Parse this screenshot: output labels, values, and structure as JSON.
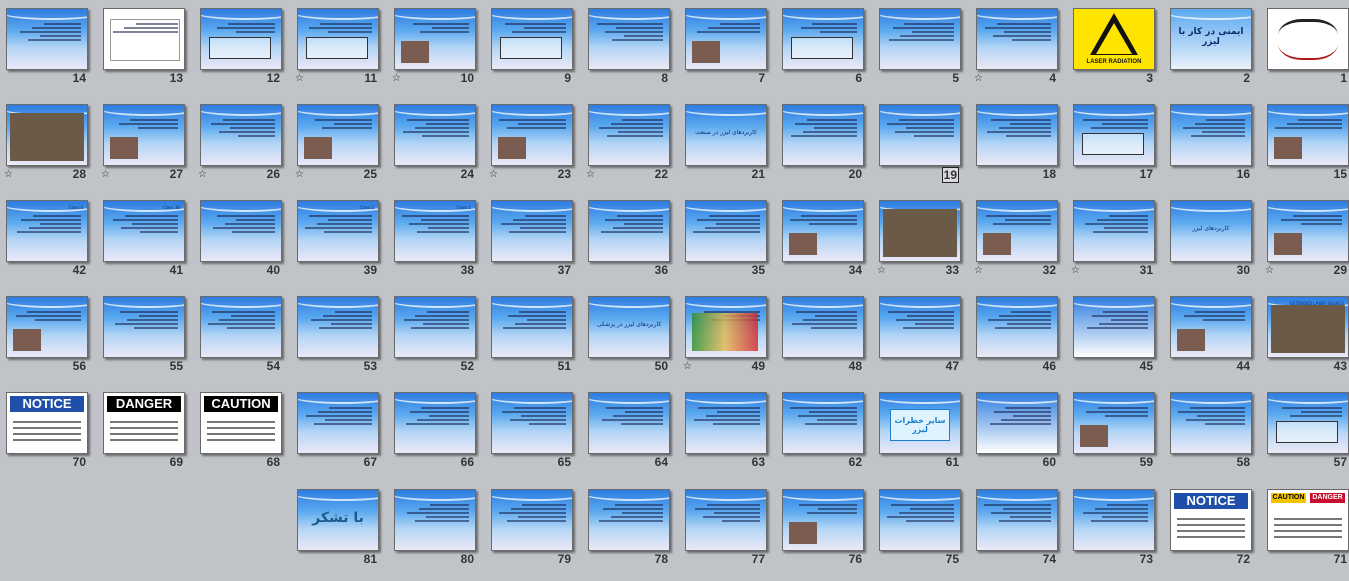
{
  "window": {
    "view": "Slide Sorter"
  },
  "slides": [
    {
      "num": "14",
      "kind": "text",
      "title": "",
      "star": false
    },
    {
      "num": "13",
      "kind": "diagram-white",
      "title": "",
      "star": false
    },
    {
      "num": "12",
      "kind": "diagram",
      "title": "",
      "star": false
    },
    {
      "num": "11",
      "kind": "diagram",
      "title": "",
      "star": true
    },
    {
      "num": "10",
      "kind": "text-image",
      "title": "",
      "star": true
    },
    {
      "num": "9",
      "kind": "diagram",
      "title": "",
      "star": false
    },
    {
      "num": "8",
      "kind": "text",
      "title": "",
      "star": false
    },
    {
      "num": "7",
      "kind": "text-image",
      "title": "",
      "star": false
    },
    {
      "num": "6",
      "kind": "diagram",
      "title": "",
      "star": false
    },
    {
      "num": "5",
      "kind": "text",
      "title": "",
      "star": false
    },
    {
      "num": "4",
      "kind": "text",
      "title": "",
      "star": true
    },
    {
      "num": "3",
      "kind": "laser-sign",
      "caption": "LASER RADIATION",
      "star": false
    },
    {
      "num": "2",
      "kind": "title-slide",
      "title": "ایمنی در کار با لیزر",
      "star": false
    },
    {
      "num": "1",
      "kind": "calligraphy",
      "title": "",
      "star": false
    },
    {
      "num": "28",
      "kind": "photo",
      "title": "",
      "star": true
    },
    {
      "num": "27",
      "kind": "text-image",
      "title": "",
      "star": true
    },
    {
      "num": "26",
      "kind": "text",
      "title": "",
      "star": true
    },
    {
      "num": "25",
      "kind": "text-image",
      "title": "",
      "star": true
    },
    {
      "num": "24",
      "kind": "text",
      "title": "",
      "star": false
    },
    {
      "num": "23",
      "kind": "text-image",
      "title": "",
      "star": true
    },
    {
      "num": "22",
      "kind": "text",
      "title": "",
      "star": true
    },
    {
      "num": "21",
      "kind": "center",
      "title": "کاربردهای لیزر در صنعت",
      "star": false
    },
    {
      "num": "20",
      "kind": "text",
      "title": "",
      "star": false
    },
    {
      "num": "19",
      "kind": "text",
      "title": "",
      "star": false,
      "selected": true
    },
    {
      "num": "18",
      "kind": "text",
      "title": "",
      "star": false
    },
    {
      "num": "17",
      "kind": "diagram",
      "title": "",
      "star": false
    },
    {
      "num": "16",
      "kind": "text",
      "title": "",
      "star": false
    },
    {
      "num": "15",
      "kind": "text-image",
      "title": "",
      "star": false
    },
    {
      "num": "42",
      "kind": "text",
      "title": "Class 4",
      "star": false
    },
    {
      "num": "41",
      "kind": "text",
      "title": "Class 3B",
      "star": false
    },
    {
      "num": "40",
      "kind": "text",
      "title": "",
      "star": false
    },
    {
      "num": "39",
      "kind": "text",
      "title": "Class 2",
      "star": false
    },
    {
      "num": "38",
      "kind": "text",
      "title": "Class 1",
      "star": false
    },
    {
      "num": "37",
      "kind": "text",
      "title": "",
      "star": false
    },
    {
      "num": "36",
      "kind": "text",
      "title": "",
      "star": false
    },
    {
      "num": "35",
      "kind": "text",
      "title": "",
      "star": false
    },
    {
      "num": "34",
      "kind": "text-image",
      "title": "",
      "star": false
    },
    {
      "num": "33",
      "kind": "photo",
      "title": "",
      "star": true
    },
    {
      "num": "32",
      "kind": "text-image",
      "title": "",
      "star": true
    },
    {
      "num": "31",
      "kind": "text",
      "title": "",
      "star": true
    },
    {
      "num": "30",
      "kind": "center",
      "title": "کاربردهای لیزر",
      "star": false
    },
    {
      "num": "29",
      "kind": "text-image",
      "title": "",
      "star": true
    },
    {
      "num": "56",
      "kind": "text-image",
      "title": "",
      "star": false
    },
    {
      "num": "55",
      "kind": "text",
      "title": "",
      "star": false
    },
    {
      "num": "54",
      "kind": "text",
      "title": "",
      "star": false
    },
    {
      "num": "53",
      "kind": "text",
      "title": "",
      "star": false
    },
    {
      "num": "52",
      "kind": "text",
      "title": "",
      "star": false
    },
    {
      "num": "51",
      "kind": "text",
      "title": "",
      "star": false
    },
    {
      "num": "50",
      "kind": "center",
      "title": "کاربردهای لیزر در پزشکی",
      "star": false
    },
    {
      "num": "49",
      "kind": "cartoon",
      "title": "",
      "star": true
    },
    {
      "num": "48",
      "kind": "text",
      "title": "",
      "star": false
    },
    {
      "num": "47",
      "kind": "text",
      "title": "",
      "star": false
    },
    {
      "num": "46",
      "kind": "text",
      "title": "",
      "star": false
    },
    {
      "num": "45",
      "kind": "table",
      "title": "",
      "star": false
    },
    {
      "num": "44",
      "kind": "text-image",
      "title": "",
      "star": false
    },
    {
      "num": "43",
      "kind": "photo",
      "title": "EXTENDED LASER SOURCE",
      "star": false
    },
    {
      "num": "70",
      "kind": "sign",
      "sign": "NOTICE",
      "star": false
    },
    {
      "num": "69",
      "kind": "sign",
      "sign": "DANGER",
      "star": false
    },
    {
      "num": "68",
      "kind": "sign",
      "sign": "CAUTION",
      "star": false
    },
    {
      "num": "67",
      "kind": "text",
      "title": "",
      "star": false
    },
    {
      "num": "66",
      "kind": "text",
      "title": "",
      "star": false
    },
    {
      "num": "65",
      "kind": "text",
      "title": "",
      "star": false
    },
    {
      "num": "64",
      "kind": "text",
      "title": "",
      "star": false
    },
    {
      "num": "63",
      "kind": "text",
      "title": "",
      "star": false
    },
    {
      "num": "62",
      "kind": "text",
      "title": "",
      "star": false
    },
    {
      "num": "61",
      "kind": "boxed",
      "title": "سایر خطرات لیزر",
      "star": false
    },
    {
      "num": "60",
      "kind": "table",
      "title": "",
      "star": false
    },
    {
      "num": "59",
      "kind": "text-image",
      "title": "",
      "star": false
    },
    {
      "num": "58",
      "kind": "text",
      "title": "",
      "star": false
    },
    {
      "num": "57",
      "kind": "diagram",
      "title": "",
      "star": false
    },
    {
      "num": "81",
      "kind": "center-big",
      "title": "با تشکر",
      "star": false
    },
    {
      "num": "80",
      "kind": "text",
      "title": "",
      "star": false
    },
    {
      "num": "79",
      "kind": "text",
      "title": "",
      "star": false
    },
    {
      "num": "78",
      "kind": "text",
      "title": "",
      "star": false
    },
    {
      "num": "77",
      "kind": "text",
      "title": "",
      "star": false
    },
    {
      "num": "76",
      "kind": "text-image",
      "title": "",
      "star": false
    },
    {
      "num": "75",
      "kind": "text",
      "title": "",
      "star": false
    },
    {
      "num": "74",
      "kind": "text",
      "title": "",
      "star": false
    },
    {
      "num": "73",
      "kind": "text",
      "title": "",
      "star": false
    },
    {
      "num": "72",
      "kind": "sign",
      "sign": "NOTICE",
      "star": false
    },
    {
      "num": "71",
      "kind": "signs-pair",
      "sign": "CAUTION",
      "sign2": "DANGER",
      "star": false
    }
  ],
  "colors": {
    "danger": "#000000",
    "caution": "#000000",
    "notice": "#1f4fa8",
    "accent_text": "#0a2f70"
  },
  "icons": {
    "star": "transition-star-icon"
  }
}
